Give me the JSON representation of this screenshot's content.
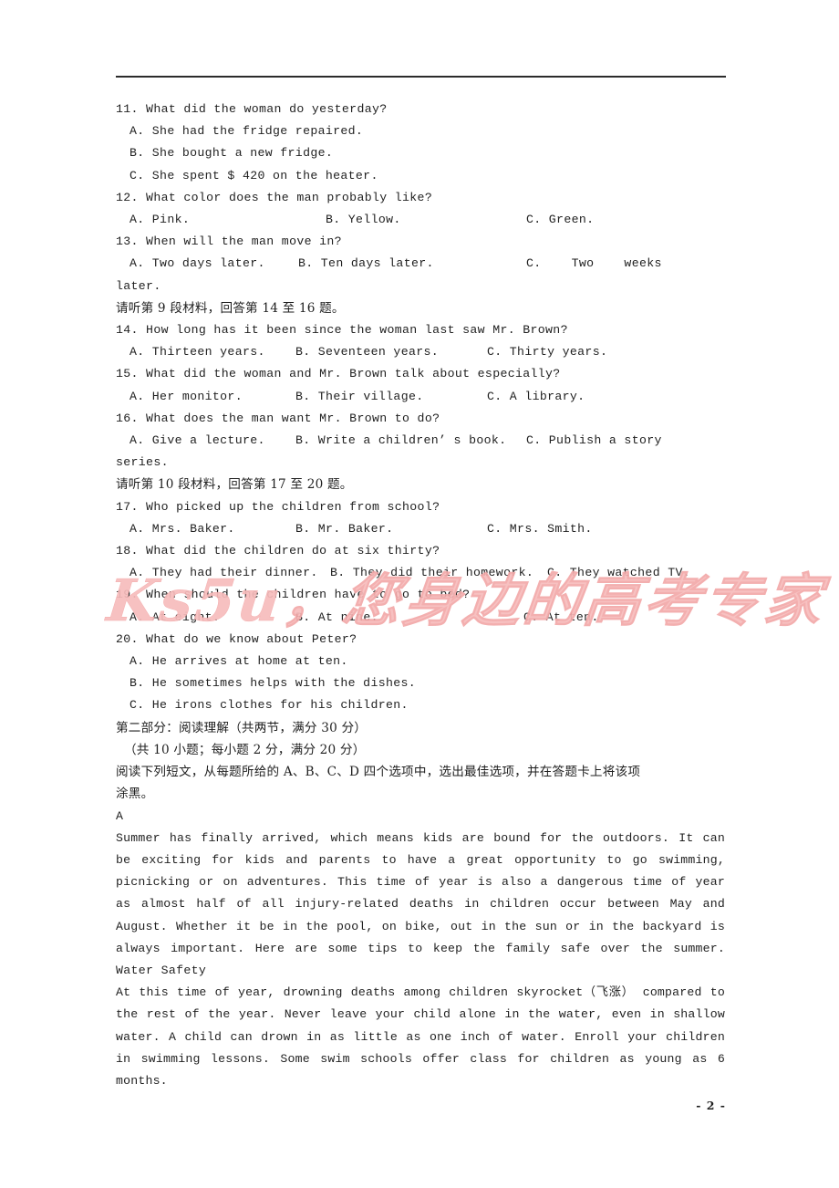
{
  "document": {
    "page_number_label": "- 2 -",
    "watermark": "Ks5u，您身边的高考专家",
    "watermark_color": "#f7bcbc",
    "text_color": "#1f1f1f",
    "rule_color": "#2b2b2b"
  },
  "listening": {
    "questions": [
      {
        "number": "11.",
        "stem": "11. What did the woman do yesterday?",
        "layout": "stacked",
        "options": [
          "A. She had the fridge repaired.",
          "B. She bought a new fridge.",
          "C. She spent $ 420 on the heater."
        ]
      },
      {
        "number": "12.",
        "stem": "12. What color does the man probably like?",
        "layout": "columns",
        "options": [
          "A. Pink.",
          "B. Yellow.",
          "C. Green."
        ]
      },
      {
        "number": "13.",
        "stem": "13. When will the man move in?",
        "layout": "columns-wrap",
        "options": [
          "A. Two days later.",
          "B. Ten days later.",
          "C.    Two    weeks"
        ],
        "wrap_tail": "later."
      }
    ],
    "direction_9": "请听第 9 段材料，回答第 14 至 16 题。",
    "questions_9": [
      {
        "number": "14.",
        "stem": "14. How long has it been since the woman last saw Mr. Brown?",
        "layout": "columns",
        "options": [
          "A. Thirteen years.",
          "B. Seventeen years.",
          "C. Thirty years."
        ]
      },
      {
        "number": "15.",
        "stem": "15. What did the woman and Mr. Brown talk about especially?",
        "layout": "columns",
        "options": [
          "A. Her monitor.",
          "B. Their village.",
          "C. A library."
        ]
      },
      {
        "number": "16.",
        "stem": "16. What does the man want Mr. Brown to do?",
        "layout": "columns-wrap",
        "options": [
          "A. Give a lecture.",
          "B. Write a children’ s book.",
          "C. Publish a story"
        ],
        "wrap_tail": "series."
      }
    ],
    "direction_10": "请听第 10 段材料，回答第 17 至 20 题。",
    "questions_10": [
      {
        "number": "17.",
        "stem": "17. Who picked up the children from school?",
        "layout": "columns",
        "options": [
          "A. Mrs. Baker.",
          "B. Mr. Baker.",
          "C. Mrs. Smith."
        ]
      },
      {
        "number": "18.",
        "stem": "18. What did the children do at six thirty?",
        "layout": "columns-tight",
        "options": [
          "A. They had their dinner.",
          "B. They did their homework.",
          "C. They watched TV."
        ]
      },
      {
        "number": "19.",
        "stem": "19. When should the children have to go to bed?",
        "layout": "columns",
        "options": [
          "A. At eight.",
          "B. At nine.",
          "C. At ten."
        ]
      },
      {
        "number": "20.",
        "stem": "20. What do we know about Peter?",
        "layout": "stacked",
        "options": [
          "A. He arrives at home at ten.",
          "B. He sometimes helps with the dishes.",
          "C. He irons clothes for his children."
        ]
      }
    ]
  },
  "part_two": {
    "heading": "第二部分：阅读理解（共两节，满分 30 分）",
    "subheading": "（共 10 小题；每小题 2 分，满分 20 分）",
    "instruction_line1": "阅读下列短文，从每题所给的 A、B、C、D 四个选项中，选出最佳选项，并在答题卡上将该项",
    "instruction_line2": "涂黑。",
    "section_label": "A",
    "passage": {
      "paragraph1": "Summer has finally arrived, which means kids are bound for the outdoors. It can be exciting for kids and parents to have a great opportunity to go swimming, picnicking or on adventures. This time of year is also a dangerous time of year as almost half of all injury-related deaths in children occur between May and August. Whether it be in the pool, on bike, out in the sun or in the backyard is always important. Here are some tips to keep the family safe over the summer.",
      "subtitle": "Water Safety",
      "paragraph2": "At this time of year, drowning deaths among children skyrocket（飞涨） compared to the rest of the year. Never leave your child alone in the water, even in shallow water. A child can drown in as little as one inch of water. Enroll your children in swimming lessons. Some swim schools offer class for children as young as 6 months."
    }
  }
}
